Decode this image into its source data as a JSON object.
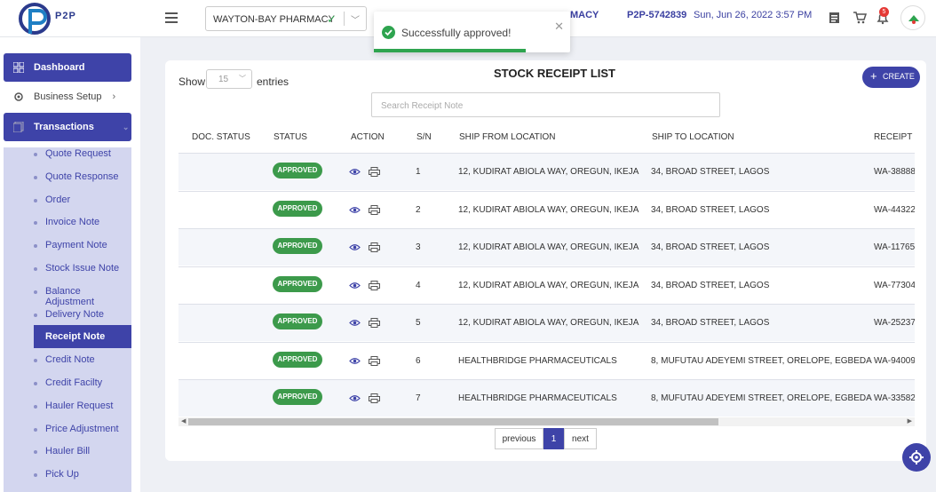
{
  "brand": {
    "name": "P2P"
  },
  "header": {
    "store_name": "WAYTON-BAY PHARMACY",
    "store_tail": "MACY",
    "ref_no": "P2P-5742839",
    "datetime": "Sun, Jun 26, 2022 3:57 PM",
    "notification_count": "5"
  },
  "toast": {
    "message": "Successfully approved!"
  },
  "sidebar": {
    "dashboard": "Dashboard",
    "business_setup": "Business Setup",
    "transactions": "Transactions",
    "items": [
      {
        "label": "Quote Request"
      },
      {
        "label": "Quote Response"
      },
      {
        "label": "Order"
      },
      {
        "label": "Invoice Note"
      },
      {
        "label": "Payment Note"
      },
      {
        "label": "Stock Issue Note"
      },
      {
        "label": "Balance Adjustment"
      },
      {
        "label": "Delivery Note"
      },
      {
        "label": "Receipt Note",
        "selected": true
      },
      {
        "label": "Credit Note"
      },
      {
        "label": "Credit Facilty"
      },
      {
        "label": "Hauler Request"
      },
      {
        "label": "Price Adjustment"
      },
      {
        "label": "Hauler Bill"
      },
      {
        "label": "Pick Up"
      }
    ]
  },
  "main": {
    "title": "STOCK RECEIPT LIST",
    "show_label": "Show",
    "entries_value": "15",
    "entries_label": "entries",
    "create_label": "CREATE",
    "search_placeholder": "Search Receipt Note",
    "columns": [
      "DOC. STATUS",
      "STATUS",
      "ACTION",
      "S/N",
      "SHIP FROM LOCATION",
      "SHIP TO LOCATION",
      "RECEIPT N"
    ],
    "rows": [
      {
        "status": "APPROVED",
        "sn": "1",
        "from": "12, KUDIRAT ABIOLA WAY, OREGUN, IKEJA",
        "to": "34, BROAD STREET, LAGOS",
        "receipt": "WA-38888"
      },
      {
        "status": "APPROVED",
        "sn": "2",
        "from": "12, KUDIRAT ABIOLA WAY, OREGUN, IKEJA",
        "to": "34, BROAD STREET, LAGOS",
        "receipt": "WA-44322"
      },
      {
        "status": "APPROVED",
        "sn": "3",
        "from": "12, KUDIRAT ABIOLA WAY, OREGUN, IKEJA",
        "to": "34, BROAD STREET, LAGOS",
        "receipt": "WA-11765"
      },
      {
        "status": "APPROVED",
        "sn": "4",
        "from": "12, KUDIRAT ABIOLA WAY, OREGUN, IKEJA",
        "to": "34, BROAD STREET, LAGOS",
        "receipt": "WA-77304"
      },
      {
        "status": "APPROVED",
        "sn": "5",
        "from": "12, KUDIRAT ABIOLA WAY, OREGUN, IKEJA",
        "to": "34, BROAD STREET, LAGOS",
        "receipt": "WA-25237"
      },
      {
        "status": "APPROVED",
        "sn": "6",
        "from": "HEALTHBRIDGE PHARMACEUTICALS",
        "to": "8, MUFUTAU ADEYEMI STREET, ORELOPE, EGBEDA",
        "receipt": "WA-94009"
      },
      {
        "status": "APPROVED",
        "sn": "7",
        "from": "HEALTHBRIDGE PHARMACEUTICALS",
        "to": "8, MUFUTAU ADEYEMI STREET, ORELOPE, EGBEDA",
        "receipt": "WA-33582"
      }
    ],
    "pagination": {
      "previous": "previous",
      "current": "1",
      "next": "next"
    }
  },
  "colors": {
    "primary": "#3e43a8",
    "approved": "#3c9a4b",
    "toast_success": "#2ea44f",
    "sidebar_sub_bg": "#d3d6ef"
  }
}
